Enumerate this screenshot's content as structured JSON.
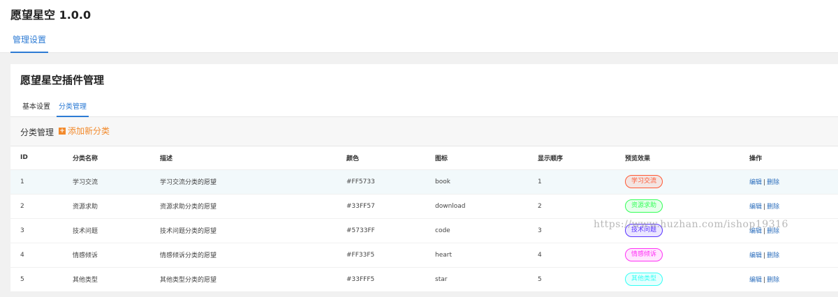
{
  "app": {
    "title": "愿望星空 1.0.0",
    "top_tab": "管理设置"
  },
  "card": {
    "title": "愿望星空插件管理",
    "tabs": [
      "基本设置",
      "分类管理"
    ],
    "section_title": "分类管理",
    "add_label": "添加新分类"
  },
  "table": {
    "headers": [
      "ID",
      "分类名称",
      "描述",
      "颜色",
      "图标",
      "显示顺序",
      "预览效果",
      "操作"
    ],
    "rows": [
      {
        "id": "1",
        "name": "学习交流",
        "desc": "学习交流分类的愿望",
        "color": "#FF5733",
        "icon": "book",
        "order": "1",
        "preview": "学习交流",
        "edit": "编辑",
        "sep": "|",
        "del": "删除"
      },
      {
        "id": "2",
        "name": "资源求助",
        "desc": "资源求助分类的愿望",
        "color": "#33FF57",
        "icon": "download",
        "order": "2",
        "preview": "资源求助",
        "edit": "编辑",
        "sep": "|",
        "del": "删除"
      },
      {
        "id": "3",
        "name": "技术问题",
        "desc": "技术问题分类的愿望",
        "color": "#5733FF",
        "icon": "code",
        "order": "3",
        "preview": "技术问题",
        "edit": "编辑",
        "sep": "|",
        "del": "删除"
      },
      {
        "id": "4",
        "name": "情感倾诉",
        "desc": "情感倾诉分类的愿望",
        "color": "#FF33F5",
        "icon": "heart",
        "order": "4",
        "preview": "情感倾诉",
        "edit": "编辑",
        "sep": "|",
        "del": "删除"
      },
      {
        "id": "5",
        "name": "其他类型",
        "desc": "其他类型分类的愿望",
        "color": "#33FFF5",
        "icon": "star",
        "order": "5",
        "preview": "其他类型",
        "edit": "编辑",
        "sep": "|",
        "del": "删除"
      }
    ]
  },
  "watermark": "https://www.huzhan.com/ishop19316"
}
